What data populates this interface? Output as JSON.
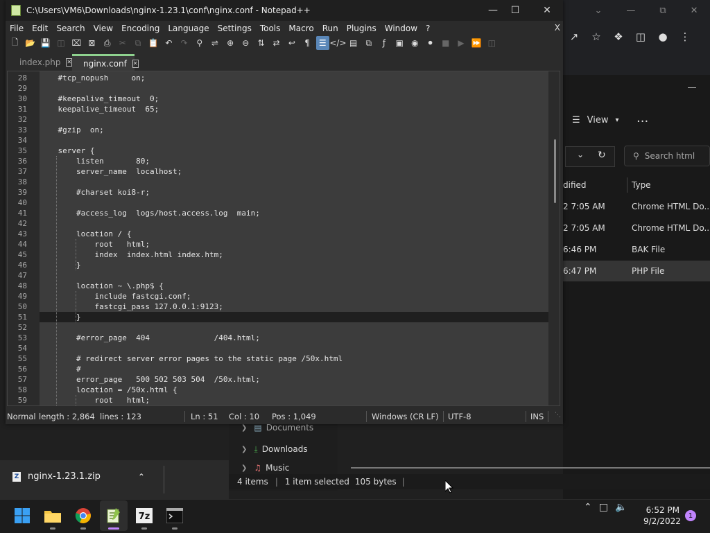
{
  "notepad": {
    "title": "C:\\Users\\VM6\\Downloads\\nginx-1.23.1\\conf\\nginx.conf - Notepad++",
    "menu": [
      "File",
      "Edit",
      "Search",
      "View",
      "Encoding",
      "Language",
      "Settings",
      "Tools",
      "Macro",
      "Run",
      "Plugins",
      "Window",
      "?"
    ],
    "menu_close": "X",
    "tabs": [
      {
        "label": "index.php",
        "active": false
      },
      {
        "label": "nginx.conf",
        "active": true
      }
    ],
    "lines": [
      {
        "n": "28",
        "text": "    #tcp_nopush     on;"
      },
      {
        "n": "29",
        "text": ""
      },
      {
        "n": "30",
        "text": "    #keepalive_timeout  0;"
      },
      {
        "n": "31",
        "text": "    keepalive_timeout  65;"
      },
      {
        "n": "32",
        "text": ""
      },
      {
        "n": "33",
        "text": "    #gzip  on;"
      },
      {
        "n": "34",
        "text": ""
      },
      {
        "n": "35",
        "text": "    server {"
      },
      {
        "n": "36",
        "text": "        listen       80;"
      },
      {
        "n": "37",
        "text": "        server_name  localhost;"
      },
      {
        "n": "38",
        "text": ""
      },
      {
        "n": "39",
        "text": "        #charset koi8-r;"
      },
      {
        "n": "40",
        "text": ""
      },
      {
        "n": "41",
        "text": "        #access_log  logs/host.access.log  main;"
      },
      {
        "n": "42",
        "text": ""
      },
      {
        "n": "43",
        "text": "        location / {"
      },
      {
        "n": "44",
        "text": "            root   html;"
      },
      {
        "n": "45",
        "text": "            index  index.html index.htm;"
      },
      {
        "n": "46",
        "text": "        }"
      },
      {
        "n": "47",
        "text": ""
      },
      {
        "n": "48",
        "text": "        location ~ \\.php$ {"
      },
      {
        "n": "49",
        "text": "            include fastcgi.conf;"
      },
      {
        "n": "50",
        "text": "            fastcgi_pass 127.0.0.1:9123;"
      },
      {
        "n": "51",
        "text": "        }"
      },
      {
        "n": "52",
        "text": ""
      },
      {
        "n": "53",
        "text": "        #error_page  404              /404.html;"
      },
      {
        "n": "54",
        "text": ""
      },
      {
        "n": "55",
        "text": "        # redirect server error pages to the static page /50x.html"
      },
      {
        "n": "56",
        "text": "        #"
      },
      {
        "n": "57",
        "text": "        error_page   500 502 503 504  /50x.html;"
      },
      {
        "n": "58",
        "text": "        location = /50x.html {"
      },
      {
        "n": "59",
        "text": "            root   html;"
      }
    ],
    "current_line": "51",
    "status": {
      "mode": "Normal",
      "length": "length : 2,864",
      "lines": "lines : 123",
      "ln": "Ln : 51",
      "col": "Col : 10",
      "pos": "Pos : 1,049",
      "eol": "Windows (CR LF)",
      "encoding": "UTF-8",
      "ins": "INS"
    }
  },
  "explorer": {
    "view_label": "View",
    "more": "...",
    "search_placeholder": "Search html",
    "col_modified": "dified",
    "col_type": "Type",
    "rows": [
      {
        "modified": "2 7:05 AM",
        "type": "Chrome HTML Do...",
        "selected": false
      },
      {
        "modified": "2 7:05 AM",
        "type": "Chrome HTML Do...",
        "selected": false
      },
      {
        "modified": "6:46 PM",
        "type": "BAK File",
        "selected": false
      },
      {
        "modified": "6:47 PM",
        "type": "PHP File",
        "selected": true
      }
    ],
    "nav": [
      "Documents",
      "Downloads",
      "Music"
    ],
    "status_items": "4 items",
    "status_selected": "1 item selected",
    "status_size": "105 bytes"
  },
  "download": {
    "file": "nginx-1.23.1.zip"
  },
  "taskbar": {
    "time": "6:52 PM",
    "date": "9/2/2022",
    "notifications": "1"
  },
  "colors": {
    "accent": "#5a87b8",
    "tab_indicator": "#8fd28f",
    "taskbar_active": "#c084fc"
  }
}
